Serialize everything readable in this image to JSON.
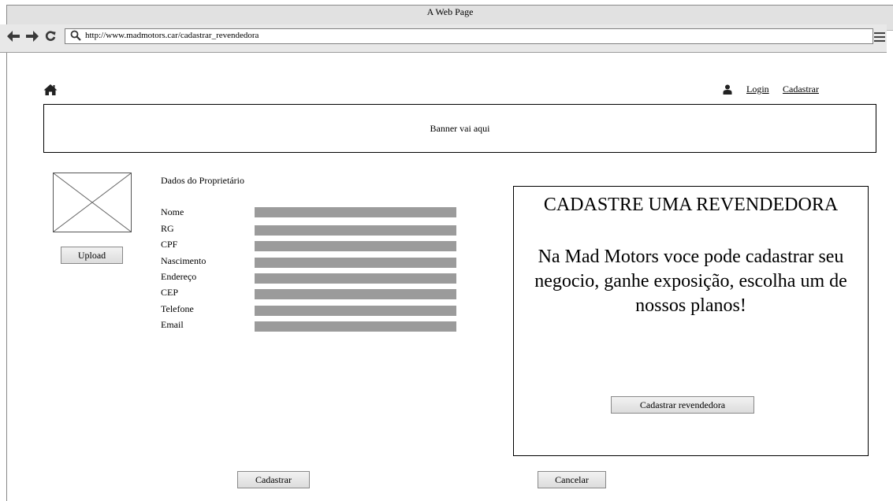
{
  "window": {
    "title": "A Web Page"
  },
  "browser": {
    "url": "http://www.madmotors.car/cadastrar_revendedora",
    "back_glyph": "🡐",
    "forward_glyph": "🡒",
    "reload_glyph": "C"
  },
  "header": {
    "login_label": "Login",
    "signup_label": "Cadastrar"
  },
  "banner": {
    "text": "Banner vai aqui"
  },
  "owner_form": {
    "upload_label": "Upload",
    "section_title": "Dados do Proprietário",
    "fields": [
      {
        "label": "Nome",
        "value": ""
      },
      {
        "label": "RG",
        "value": ""
      },
      {
        "label": "CPF",
        "value": ""
      },
      {
        "label": "Nascimento",
        "value": ""
      },
      {
        "label": "Endereço",
        "value": ""
      },
      {
        "label": "CEP",
        "value": ""
      },
      {
        "label": "Telefone",
        "value": ""
      },
      {
        "label": "Email",
        "value": ""
      }
    ],
    "submit_label": "Cadastrar",
    "cancel_label": "Cancelar"
  },
  "promo": {
    "title": "CADASTRE UMA REVENDEDORA",
    "text": "Na Mad Motors voce pode cadastrar seu negocio, ganhe exposição, escolha um de nossos planos!",
    "button_label": "Cadastrar revendedora"
  },
  "icons": {
    "home": "home-icon",
    "user": "user-icon",
    "search": "search-icon",
    "menu": "hamburger-menu-icon",
    "image_placeholder": "image-placeholder-icon"
  }
}
